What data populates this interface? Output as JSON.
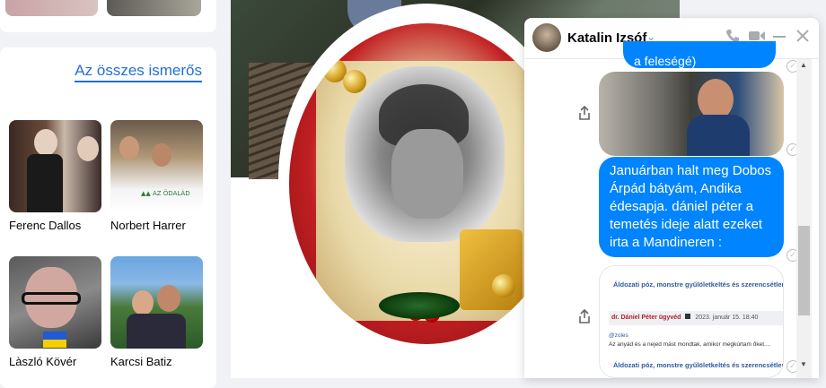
{
  "friends": {
    "all_link": "Az összes ismerős",
    "items": [
      {
        "name": "Ferenc Dallos"
      },
      {
        "name": "Norbert Harrer"
      },
      {
        "name": "Làszló Kövér"
      },
      {
        "name": "Karcsi Batiz"
      }
    ]
  },
  "chat": {
    "name": "Katalin Izsóf",
    "partial_message": "a feleségé)",
    "message": "Januárban halt meg Dobos Árpád bátyám, Andika édesapja. dániel péter a temetés ideje alatt ezeket irta a Mandineren :",
    "link_preview": {
      "title": "Áldozati póz, monstre gyűlöletkeltés és szerencsétlenné",
      "author": "dr. Dániel Péter ügyvéd",
      "date": "2023. január 15. 18:40",
      "handle": "@zoles",
      "text": "Az anyád és a nejed mást mondtak, amikor megkúrtam őket....",
      "title_repeat": "Áldozati póz, monstre gyűlöletkeltés és szerencsétlenné"
    }
  },
  "colors": {
    "accent": "#0084ff",
    "link": "#216fdb"
  }
}
